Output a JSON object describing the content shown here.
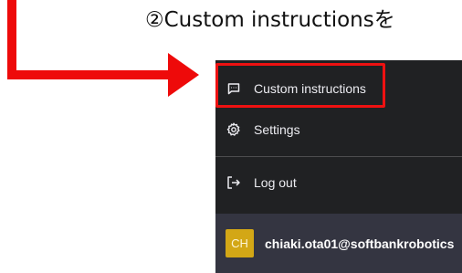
{
  "annotation": {
    "step_caption": "②Custom instructionsを",
    "arrow_color": "#ee0a0a",
    "highlight_color": "#ee1111"
  },
  "menu": {
    "background_color": "#202123",
    "items": [
      {
        "label": "Custom instructions",
        "icon": "message-square-icon"
      },
      {
        "label": "Settings",
        "icon": "gear-icon"
      },
      {
        "label": "Log out",
        "icon": "logout-icon"
      }
    ]
  },
  "user": {
    "avatar_initials": "CH",
    "avatar_color": "#d3a716",
    "email": "chiaki.ota01@softbankrobotics"
  }
}
